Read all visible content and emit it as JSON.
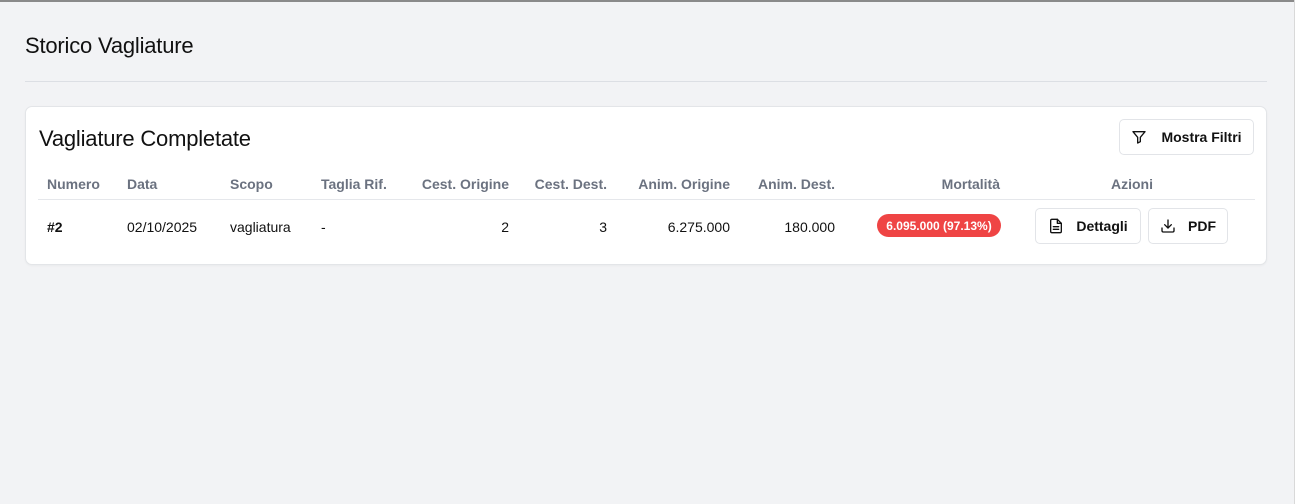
{
  "page": {
    "title": "Storico Vagliature"
  },
  "card": {
    "title": "Vagliature Completate",
    "filter_button": {
      "label": "Mostra Filtri",
      "icon": "filter-icon"
    }
  },
  "table": {
    "columns": [
      "Numero",
      "Data",
      "Scopo",
      "Taglia Rif.",
      "Cest. Origine",
      "Cest. Dest.",
      "Anim. Origine",
      "Anim. Dest.",
      "Mortalità",
      "Azioni"
    ],
    "rows": [
      {
        "numero": "#2",
        "data": "02/10/2025",
        "scopo": "vagliatura",
        "taglia": "-",
        "cest_origine": "2",
        "cest_dest": "3",
        "anim_origine": "6.275.000",
        "anim_dest": "180.000",
        "mortalita": "6.095.000 (97.13%)",
        "actions": {
          "details_label": "Dettagli",
          "details_icon": "file-text-icon",
          "pdf_label": "PDF",
          "pdf_icon": "download-icon"
        }
      }
    ]
  },
  "colors": {
    "mortality_badge": "#ef4444",
    "background": "#f2f3f5"
  }
}
